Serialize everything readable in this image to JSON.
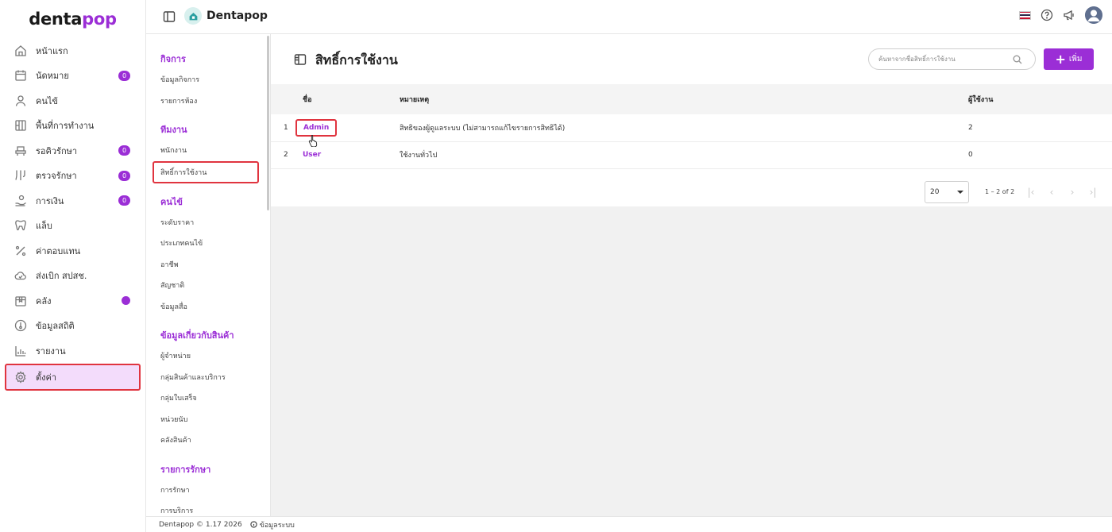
{
  "brand": {
    "logo_main": "denta",
    "logo_accent": "pop",
    "accent_color": "#9b2ed6"
  },
  "sidebar": {
    "items": [
      {
        "label": "หน้าแรก",
        "icon": "home-icon"
      },
      {
        "label": "นัดหมาย",
        "icon": "calendar-icon",
        "badge": "0"
      },
      {
        "label": "คนไข้",
        "icon": "user-icon"
      },
      {
        "label": "พื้นที่การทำงาน",
        "icon": "grid-icon"
      },
      {
        "label": "รอคิวรักษา",
        "icon": "chair-icon",
        "badge": "0"
      },
      {
        "label": "ตรวจรักษา",
        "icon": "tools-icon",
        "badge": "0"
      },
      {
        "label": "การเงิน",
        "icon": "money-hand-icon",
        "badge": "0"
      },
      {
        "label": "แล็บ",
        "icon": "tooth-icon"
      },
      {
        "label": "ค่าตอบแทน",
        "icon": "percent-icon"
      },
      {
        "label": "ส่งเบิก สปสช.",
        "icon": "cloud-icon"
      },
      {
        "label": "คลัง",
        "icon": "box-icon"
      },
      {
        "label": "ข้อมูลสถิติ",
        "icon": "thermometer-icon"
      },
      {
        "label": "รายงาน",
        "icon": "bar-chart-icon"
      },
      {
        "label": "ตั้งค่า",
        "icon": "gear-icon"
      }
    ]
  },
  "topbar": {
    "app_name": "Dentapop"
  },
  "submenu": {
    "group1": "กิจการ",
    "g1_items": [
      "ข้อมูลกิจการ",
      "รายการห้อง"
    ],
    "group2": "ทีมงาน",
    "g2_items": [
      "พนักงาน",
      "สิทธิ์การใช้งาน"
    ],
    "group3": "คนไข้",
    "g3_items": [
      "ระดับราคา",
      "ประเภทคนไข้",
      "อาชีพ",
      "สัญชาติ",
      "ข้อมูลสื่อ"
    ],
    "group4": "ข้อมูลเกี่ยวกับสินค้า",
    "g4_items": [
      "ผู้จำหน่าย",
      "กลุ่มสินค้าและบริการ",
      "กลุ่มใบเสร็จ",
      "หน่วยนับ",
      "คลังสินค้า"
    ],
    "group5": "รายการรักษา",
    "g5_items": [
      "การรักษา",
      "การบริการ"
    ]
  },
  "page": {
    "title": "สิทธิ์การใช้งาน",
    "search_placeholder": "ค้นหาจากชื่อสิทธิ์การใช้งาน",
    "add_label": "เพิ่ม"
  },
  "table": {
    "headers": {
      "name": "ชื่อ",
      "note": "หมายเหตุ",
      "users": "ผู้ใช้งาน"
    },
    "rows": [
      {
        "num": "1",
        "name": "Admin",
        "note": "สิทธิของผู้ดูแลระบบ (ไม่สามารถแก้ไขรายการสิทธิได้)",
        "users": "2"
      },
      {
        "num": "2",
        "name": "User",
        "note": "ใช้งานทั่วไป",
        "users": "0"
      }
    ]
  },
  "pager": {
    "page_size": "20",
    "range": "1 – 2 of 2"
  },
  "footer": {
    "version": "Dentapop © 1.17 2026",
    "info": "ข้อมูลระบบ"
  }
}
